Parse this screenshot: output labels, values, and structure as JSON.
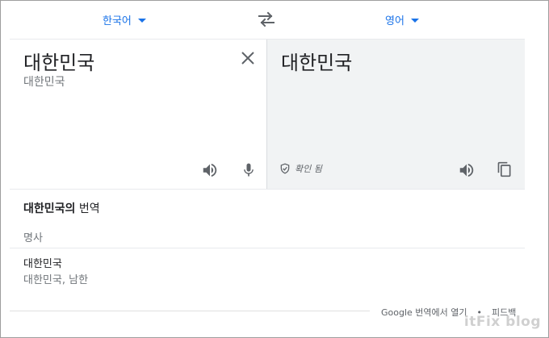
{
  "languages": {
    "source": "한국어",
    "target": "영어"
  },
  "source": {
    "text": "대한민국",
    "transliteration": "대한민국"
  },
  "target": {
    "text": "대한민국",
    "verified_label": "확인 됨"
  },
  "dictionary": {
    "title_bold": "대한민국의",
    "title_rest": " 번역",
    "part_of_speech": "명사",
    "entries": [
      {
        "word": "대한민국",
        "translations": "대한민국, 남한"
      }
    ]
  },
  "footer": {
    "open_in_google": "Google 번역에서 열기",
    "separator": "•",
    "feedback": "피드백"
  },
  "watermark": "itFix blog",
  "colors": {
    "accent": "#1a73e8",
    "target_bg": "#f1f3f4",
    "icon": "#5f6368",
    "muted_text": "#70757a"
  },
  "icons": [
    "chevron-down-icon",
    "swap-icon",
    "close-icon",
    "speaker-icon",
    "microphone-icon",
    "verified-shield-icon",
    "copy-icon"
  ]
}
